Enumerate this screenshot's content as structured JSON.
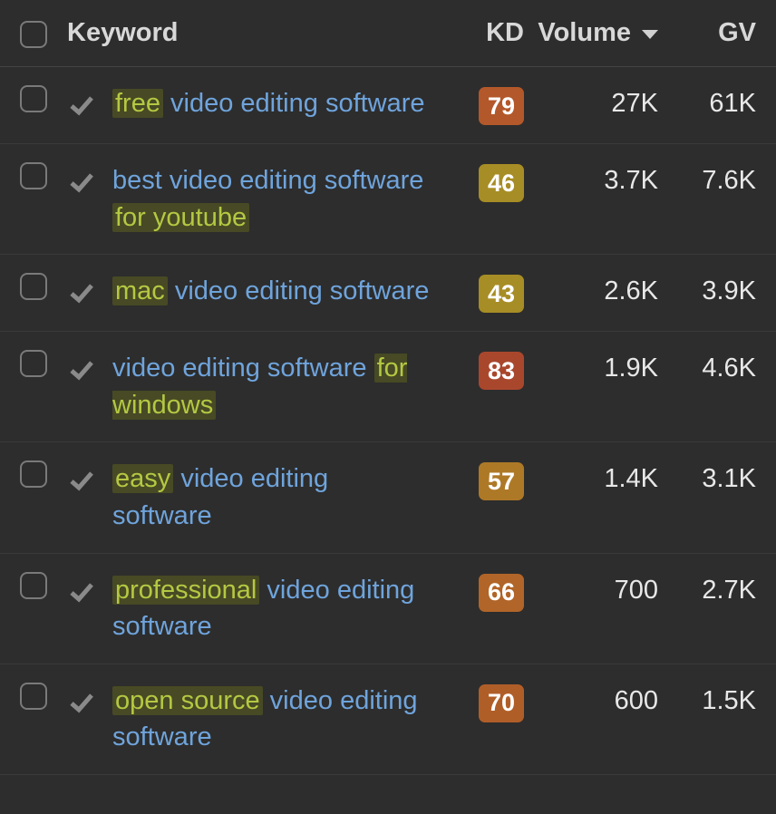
{
  "columns": {
    "keyword": "Keyword",
    "kd": "KD",
    "volume": "Volume",
    "gv": "GV"
  },
  "sorted_column": "volume",
  "rows": [
    {
      "keyword_parts": [
        {
          "text": "free",
          "highlight": true
        },
        {
          "text": " video editing software",
          "highlight": false
        }
      ],
      "kd": "79",
      "kd_class": "kd-79",
      "volume": "27K",
      "gv": "61K"
    },
    {
      "keyword_parts": [
        {
          "text": "best video editing software ",
          "highlight": false
        },
        {
          "text": "for youtube",
          "highlight": true
        }
      ],
      "kd": "46",
      "kd_class": "kd-46",
      "volume": "3.7K",
      "gv": "7.6K"
    },
    {
      "keyword_parts": [
        {
          "text": "mac",
          "highlight": true
        },
        {
          "text": " video editing software",
          "highlight": false
        }
      ],
      "kd": "43",
      "kd_class": "kd-43",
      "volume": "2.6K",
      "gv": "3.9K"
    },
    {
      "keyword_parts": [
        {
          "text": "video editing software ",
          "highlight": false
        },
        {
          "text": "for windows",
          "highlight": true
        }
      ],
      "kd": "83",
      "kd_class": "kd-83",
      "volume": "1.9K",
      "gv": "4.6K"
    },
    {
      "keyword_parts": [
        {
          "text": "easy",
          "highlight": true
        },
        {
          "text": " video editing software",
          "highlight": false
        }
      ],
      "kd": "57",
      "kd_class": "kd-57",
      "volume": "1.4K",
      "gv": "3.1K"
    },
    {
      "keyword_parts": [
        {
          "text": "professional",
          "highlight": true
        },
        {
          "text": " video editing software",
          "highlight": false
        }
      ],
      "kd": "66",
      "kd_class": "kd-66",
      "volume": "700",
      "gv": "2.7K"
    },
    {
      "keyword_parts": [
        {
          "text": "open source",
          "highlight": true
        },
        {
          "text": " video editing software",
          "highlight": false
        }
      ],
      "kd": "70",
      "kd_class": "kd-70",
      "volume": "600",
      "gv": "1.5K"
    }
  ]
}
